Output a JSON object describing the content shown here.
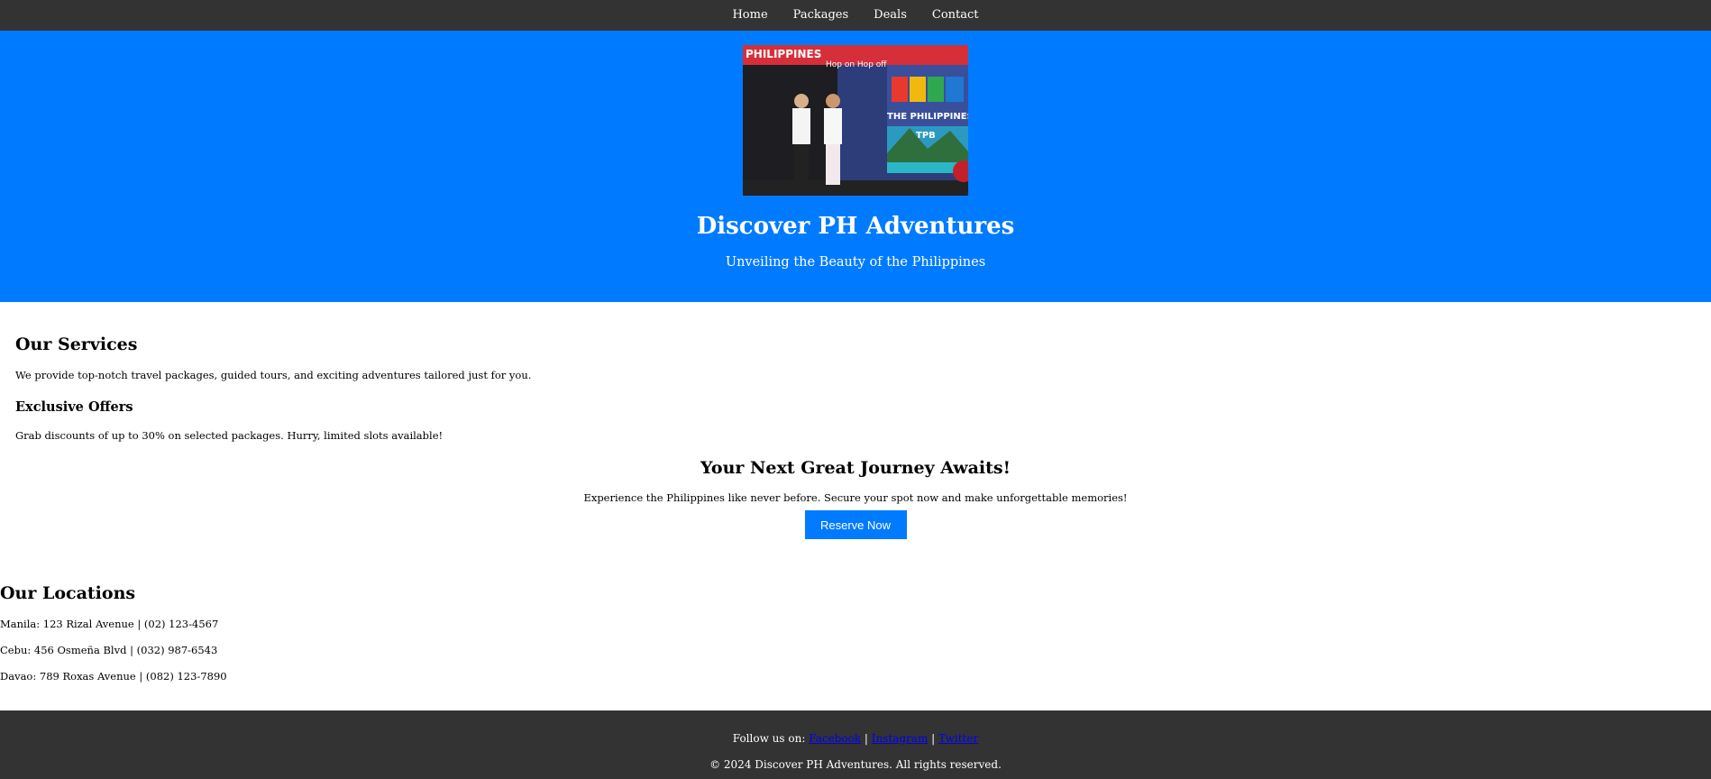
{
  "nav": {
    "items": [
      "Home",
      "Packages",
      "Deals",
      "Contact"
    ]
  },
  "hero": {
    "title": "Discover PH Adventures",
    "subtitle": "Unveiling the Beauty of the Philippines",
    "image_text": {
      "bus_brand": "PHILIPPINES",
      "bus_tag": "Hop on Hop off",
      "bus_slogan": "THE PHILIPPINES",
      "bus_logo": "TPB"
    }
  },
  "services": {
    "heading": "Our Services",
    "text": "We provide top-notch travel packages, guided tours, and exciting adventures tailored just for you."
  },
  "offers": {
    "heading": "Exclusive Offers",
    "text": "Grab discounts of up to 30% on selected packages. Hurry, limited slots available!"
  },
  "cta": {
    "heading": "Your Next Great Journey Awaits!",
    "text": "Experience the Philippines like never before. Secure your spot now and make unforgettable memories!",
    "button": "Reserve Now"
  },
  "locations": {
    "heading": "Our Locations",
    "items": [
      "Manila: 123 Rizal Avenue | (02) 123-4567",
      "Cebu: 456 Osmeña Blvd | (032) 987-6543",
      "Davao: 789 Roxas Avenue | (082) 123-7890"
    ]
  },
  "footer": {
    "follow_label": "Follow us on:",
    "links": [
      "Facebook",
      "Instagram",
      "Twitter"
    ],
    "separator": "|",
    "copyright": "© 2024 Discover PH Adventures. All rights reserved."
  },
  "colors": {
    "nav_bg": "#333333",
    "hero_bg": "#007bff",
    "button_bg": "#007bff",
    "footer_bg": "#333333",
    "link": "#0000ee"
  }
}
